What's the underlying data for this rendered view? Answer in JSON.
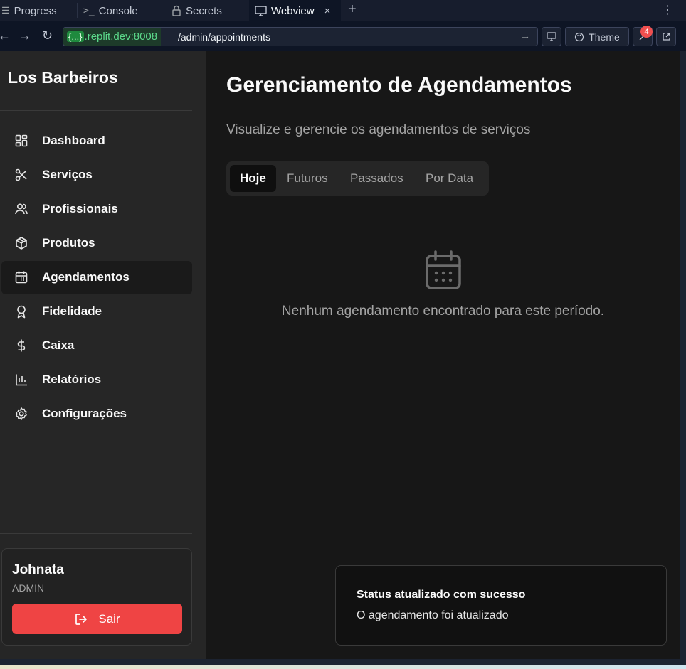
{
  "ide": {
    "tabs": [
      {
        "label": "Progress",
        "icon": "list-icon"
      },
      {
        "label": "Console",
        "icon": "terminal-icon"
      },
      {
        "label": "Secrets",
        "icon": "lock-icon"
      },
      {
        "label": "Webview",
        "icon": "monitor-icon",
        "active": true
      }
    ],
    "url_host_badge": "{...}",
    "url_host": ".replit.dev:8008",
    "url_path": "/admin/appointments",
    "theme_label": "Theme",
    "notification_count": "4"
  },
  "sidebar": {
    "brand": "Los Barbeiros",
    "items": [
      {
        "label": "Dashboard",
        "icon": "dashboard-icon"
      },
      {
        "label": "Serviços",
        "icon": "scissors-icon"
      },
      {
        "label": "Profissionais",
        "icon": "users-icon"
      },
      {
        "label": "Produtos",
        "icon": "package-icon"
      },
      {
        "label": "Agendamentos",
        "icon": "calendar-icon",
        "active": true
      },
      {
        "label": "Fidelidade",
        "icon": "award-icon"
      },
      {
        "label": "Caixa",
        "icon": "dollar-icon"
      },
      {
        "label": "Relatórios",
        "icon": "bar-chart-icon"
      },
      {
        "label": "Configurações",
        "icon": "gear-icon"
      }
    ],
    "user": {
      "name": "Johnata",
      "role": "ADMIN",
      "logout_label": "Sair"
    }
  },
  "main": {
    "title": "Gerenciamento de Agendamentos",
    "subtitle": "Visualize e gerencie os agendamentos de serviços",
    "tabs": [
      {
        "label": "Hoje",
        "active": true
      },
      {
        "label": "Futuros"
      },
      {
        "label": "Passados"
      },
      {
        "label": "Por Data"
      }
    ],
    "empty_message": "Nenhum agendamento encontrado para este período."
  },
  "toast": {
    "title": "Status atualizado com sucesso",
    "description": "O agendamento foi atualizado"
  },
  "colors": {
    "accent_red": "#ef4444",
    "sidebar_bg": "#262626",
    "main_bg": "#171717"
  }
}
